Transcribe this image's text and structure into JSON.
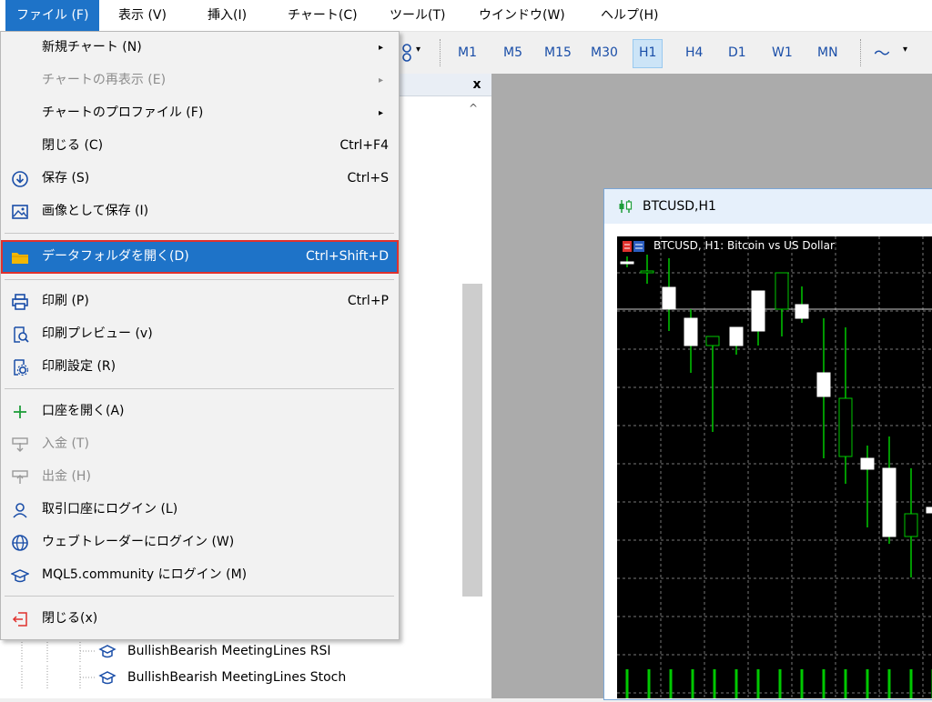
{
  "menubar": {
    "items": [
      {
        "label": "ファイル (F)"
      },
      {
        "label": "表示 (V)"
      },
      {
        "label": "挿入(I)"
      },
      {
        "label": "チャート(C)"
      },
      {
        "label": "ツール(T)"
      },
      {
        "label": "ウインドウ(W)"
      },
      {
        "label": "ヘルプ(H)"
      }
    ]
  },
  "toolbar": {
    "timeframes": [
      "M1",
      "M5",
      "M15",
      "M30",
      "H1",
      "H4",
      "D1",
      "W1",
      "MN"
    ],
    "active_timeframe": "H1",
    "arrow": "▾",
    "submenu_arrow": "▸",
    "line_glyph": "〜"
  },
  "file_menu": {
    "items": [
      {
        "label": "新規チャート (N)",
        "submenu": true
      },
      {
        "label": "チャートの再表示 (E)",
        "submenu": true,
        "disabled": true
      },
      {
        "label": "チャートのプロファイル (F)",
        "submenu": true
      },
      {
        "label": "閉じる (C)",
        "shortcut": "Ctrl+F4"
      },
      {
        "label": "保存 (S)",
        "shortcut": "Ctrl+S",
        "icon": "save-icon"
      },
      {
        "label": "画像として保存 (I)",
        "icon": "image-save-icon"
      },
      {
        "label": "データフォルダを開く(D)",
        "shortcut": "Ctrl+Shift+D",
        "icon": "folder-icon",
        "highlighted": true
      },
      {
        "label": "印刷 (P)",
        "shortcut": "Ctrl+P",
        "icon": "printer-icon"
      },
      {
        "label": "印刷プレビュー (v)",
        "icon": "print-preview-icon"
      },
      {
        "label": "印刷設定 (R)",
        "icon": "print-settings-icon"
      },
      {
        "label": "口座を開く(A)",
        "icon": "plus-icon"
      },
      {
        "label": "入金 (T)",
        "icon": "deposit-icon",
        "disabled": true
      },
      {
        "label": "出金 (H)",
        "icon": "withdraw-icon",
        "disabled": true
      },
      {
        "label": "取引口座にログイン (L)",
        "icon": "user-icon"
      },
      {
        "label": "ウェブトレーダーにログイン (W)",
        "icon": "globe-icon"
      },
      {
        "label": "MQL5.community にログイン (M)",
        "icon": "graduation-cap-icon"
      },
      {
        "label": "閉じる(x)",
        "icon": "exit-icon"
      }
    ]
  },
  "navigator": {
    "close_glyph": "x",
    "scroll_up_glyph": "^",
    "items": [
      {
        "label": "BullishBearish MeetingLines RSI"
      },
      {
        "label": "BullishBearish MeetingLines Stoch"
      }
    ]
  },
  "chart_window": {
    "title": "BTCUSD,H1",
    "label": "BTCUSD, H1:  Bitcoin vs US Dollar"
  },
  "colors": {
    "menu_highlight": "#1e73c8",
    "highlight_border": "#e0312d",
    "candle_bull": "#ffffff",
    "candle_wick": "#00c800",
    "folder": "#f2b705"
  }
}
